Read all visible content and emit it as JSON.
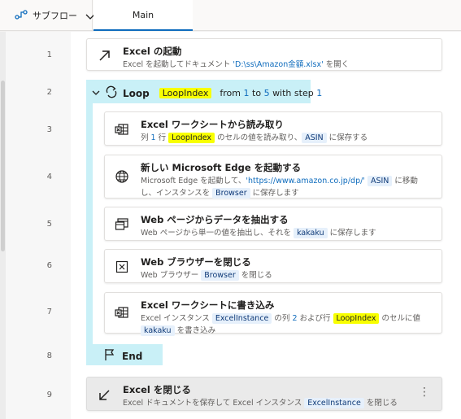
{
  "tabbar": {
    "subflow_label": "サブフロー",
    "main_tab_label": "Main"
  },
  "line_numbers": [
    "1",
    "2",
    "3",
    "4",
    "5",
    "6",
    "7",
    "8",
    "9"
  ],
  "actions": {
    "a1": {
      "title": "Excel の起動",
      "desc_pre": "Excel を起動してドキュメント ",
      "desc_str": "'D:\\ss\\Amazon金額.xlsx'",
      "desc_post": " を開く"
    },
    "loop": {
      "keyword": "Loop",
      "var": "LoopIndex",
      "from_label": "from",
      "from": "1",
      "to_label": "to",
      "to": "5",
      "step_label": "with step",
      "step": "1"
    },
    "a3": {
      "title": "Excel ワークシートから読み取り",
      "p1": "列 ",
      "num1": "1",
      "p2": " 行 ",
      "var1": "LoopIndex",
      "p3": " のセルの値を読み取り、",
      "var2": "ASIN",
      "p4": " に保存する"
    },
    "a4": {
      "title": "新しい Microsoft Edge を起動する",
      "p1": "Microsoft Edge を起動して、",
      "str1": "'https://www.amazon.co.jp/dp/'",
      "var1": "ASIN",
      "p2": " に移動",
      "p3": "し、インスタンスを ",
      "var2": "Browser",
      "p4": " に保存します"
    },
    "a5": {
      "title": "Web ページからデータを抽出する",
      "p1": "Web ページから単一の値を抽出し、それを ",
      "var1": "kakaku",
      "p2": " に保存します"
    },
    "a6": {
      "title": "Web ブラウザーを閉じる",
      "p1": "Web ブラウザー ",
      "var1": "Browser",
      "p2": " を閉じる"
    },
    "a7": {
      "title": "Excel ワークシートに書き込み",
      "p1": "Excel インスタンス ",
      "var1": "ExcelInstance",
      "p2": " の列 ",
      "num1": "2",
      "p3": " および行 ",
      "var2": "LoopIndex",
      "p4": " のセルに値",
      "var3": "kakaku",
      "p5": " を書き込み"
    },
    "end": {
      "label": "End"
    },
    "a9": {
      "title": "Excel を閉じる",
      "p1": "Excel ドキュメントを保存して Excel インスタンス ",
      "var1": "ExcelInstance",
      "p2": " を閉じる",
      "menu": "⋮"
    }
  },
  "colors": {
    "accent": "#0f6cbd",
    "loop_highlight": "#c9f0f7",
    "variable_highlight": "#f8ff00",
    "variable_chip": "#e6f0fb"
  },
  "icons": {
    "subflow": "subflow-icon",
    "chevron": "chevron-down-icon",
    "launch": "arrow-up-right-icon",
    "loop": "loop-icon",
    "sheet": "excel-sheet-icon",
    "globe": "globe-icon",
    "extract": "window-extract-icon",
    "close_browser": "close-window-icon",
    "flag": "flag-icon",
    "close_excel": "arrow-down-left-icon"
  }
}
